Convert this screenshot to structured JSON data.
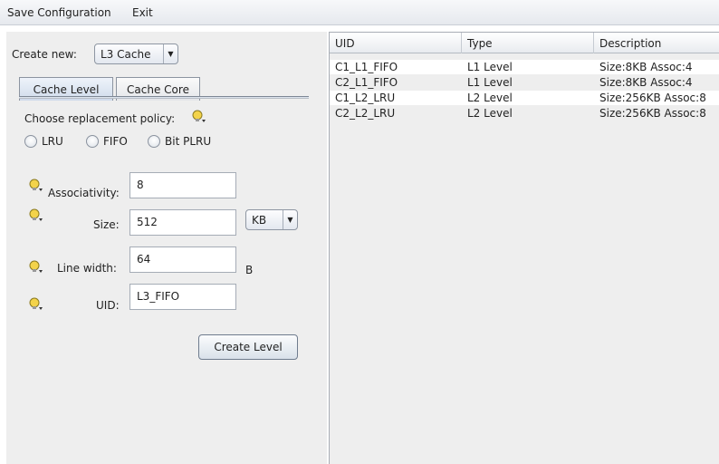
{
  "menu": {
    "items": [
      "Save Configuration",
      "Exit"
    ]
  },
  "form": {
    "create_new_label": "Create new:",
    "create_new_value": "L3 Cache",
    "tabs": [
      "Cache Level",
      "Cache Core"
    ],
    "policy_label": "Choose replacement policy:",
    "policies": [
      "LRU",
      "FIFO",
      "Bit PLRU"
    ],
    "associativity_label": "Associativity:",
    "associativity_value": "8",
    "size_label": "Size:",
    "size_value": "512",
    "size_unit": "KB",
    "line_width_label": "Line width:",
    "line_width_value": "64",
    "line_width_unit": "B",
    "uid_label": "UID:",
    "uid_value": "L3_FIFO",
    "create_button": "Create Level"
  },
  "table": {
    "columns": [
      "UID",
      "Type",
      "Description"
    ],
    "rows": [
      [
        "C1_L1_FIFO",
        "L1 Level",
        "Size:8KB Assoc:4"
      ],
      [
        "C2_L1_FIFO",
        "L1 Level",
        "Size:8KB Assoc:4"
      ],
      [
        "C1_L2_LRU",
        "L2 Level",
        "Size:256KB Assoc:8"
      ],
      [
        "C2_L2_LRU",
        "L2 Level",
        "Size:256KB Assoc:8"
      ]
    ]
  },
  "icons": {
    "hint": "lightbulb-hint-icon",
    "dropdown": "triangle-down-icon"
  },
  "colors": {
    "panel_bg": "#eeeeee",
    "active_tab": "#cfdbeb",
    "hint_yellow": "#f3d34a"
  }
}
